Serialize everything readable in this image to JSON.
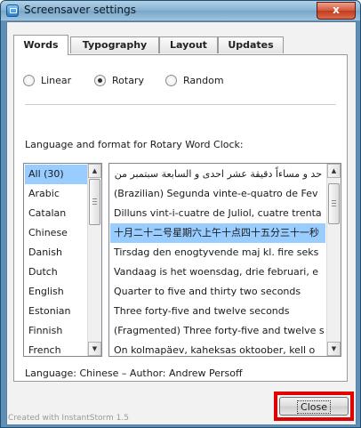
{
  "window": {
    "title": "Screensaver settings",
    "close_glyph": "x"
  },
  "tabs": [
    {
      "label": "Words",
      "active": true
    },
    {
      "label": "Typography",
      "active": false
    },
    {
      "label": "Layout",
      "active": false
    },
    {
      "label": "Updates",
      "active": false
    }
  ],
  "mode": {
    "options": [
      {
        "label": "Linear",
        "selected": false
      },
      {
        "label": "Rotary",
        "selected": true
      },
      {
        "label": "Random",
        "selected": false
      }
    ]
  },
  "language_section": {
    "caption": "Language and format for Rotary Word Clock:",
    "languages": [
      "All (30)",
      "Arabic",
      "Catalan",
      "Chinese",
      "Danish",
      "Dutch",
      "English",
      "Estonian",
      "Finnish",
      "French"
    ],
    "selected_language_index": 0,
    "phrases": [
      "حد و مساءاً دقيقة عشر احدى و السابعة سبتمبر من عشر السادس الخميس",
      "(Brazilian) Segunda vinte-e-quatro de Fev",
      "Dilluns vint-i-cuatre de Juliol, cuatre trenta",
      "十月二十二号星期六上午十点四十五分三十一秒",
      "Tirsdag den enogtyvende maj kl. fire seks",
      "Vandaag is het woensdag, drie februari, e",
      "Quarter to five and thirty two seconds",
      "Three forty-five and twelve seconds",
      "(Fragmented) Three forty-five and twelve s",
      "On kolmapäev, kaheksas oktoober, kell o"
    ],
    "selected_phrase_index": 3,
    "credit": "Language: Chinese – Author: Andrew Persoff"
  },
  "footer": {
    "created_with": "Created with InstantStorm 1.5",
    "close_label": "Close"
  },
  "colors": {
    "selection": "#99ccff",
    "highlight_box": "#e00000"
  }
}
